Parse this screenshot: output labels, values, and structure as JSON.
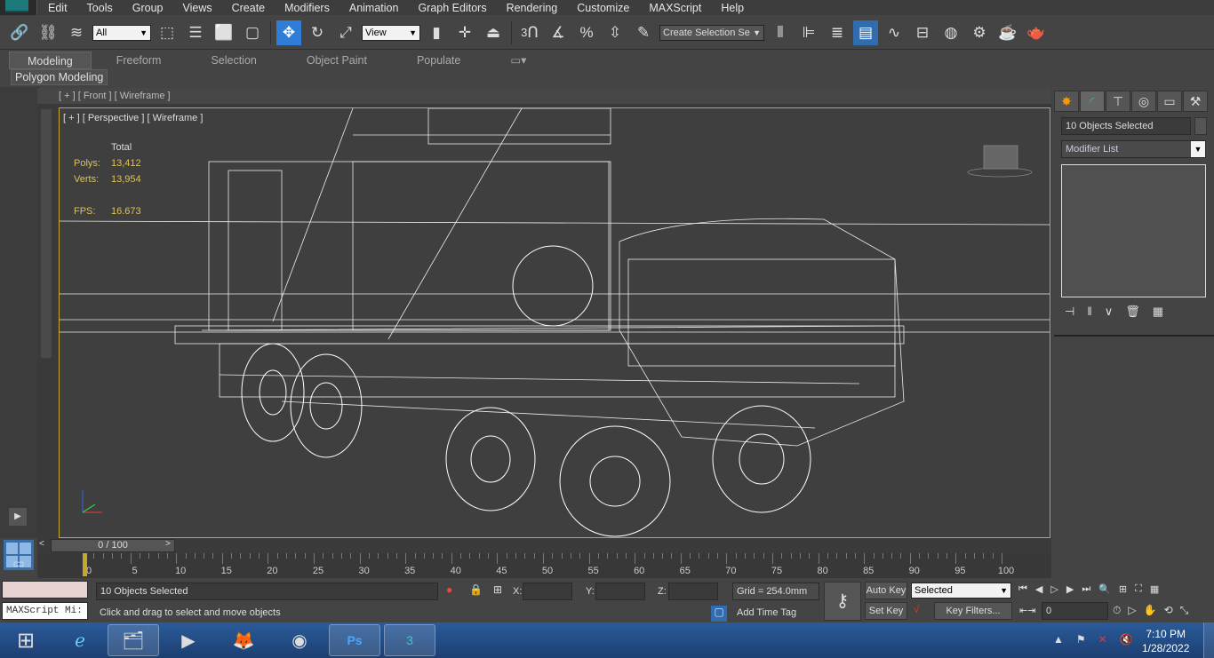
{
  "menu": [
    "Edit",
    "Tools",
    "Group",
    "Views",
    "Create",
    "Modifiers",
    "Animation",
    "Graph Editors",
    "Rendering",
    "Customize",
    "MAXScript",
    "Help"
  ],
  "toolbar": {
    "selection_filter": "All",
    "ref_coord": "View",
    "named_selection": "Create Selection Se",
    "snap_value": "3"
  },
  "ribbon": {
    "tabs": [
      "Modeling",
      "Freeform",
      "Selection",
      "Object Paint",
      "Populate"
    ],
    "active": "Modeling",
    "panel": "Polygon Modeling"
  },
  "viewports": {
    "front_label": "[ + ] [ Front ] [ Wireframe ]",
    "perspective_label": "[ + ] [ Perspective ] [ Wireframe ]"
  },
  "stats": {
    "header": "Total",
    "polys_label": "Polys:",
    "polys": "13,412",
    "verts_label": "Verts:",
    "verts": "13,954",
    "fps_label": "FPS:",
    "fps": "16.673"
  },
  "command_panel": {
    "object_name": "10 Objects Selected",
    "modifier_list": "Modifier List"
  },
  "timeline": {
    "slider": "0 / 100",
    "ticks": [
      "0",
      "5",
      "10",
      "15",
      "20",
      "25",
      "30",
      "35",
      "40",
      "45",
      "50",
      "55",
      "60",
      "65",
      "70",
      "75",
      "80",
      "85",
      "90",
      "95",
      "100"
    ]
  },
  "status": {
    "maxscript": "MAXScript Mi:",
    "selection": "10 Objects Selected",
    "prompt": "Click and drag to select and move objects",
    "x_label": "X:",
    "y_label": "Y:",
    "z_label": "Z:",
    "grid": "Grid = 254.0mm",
    "add_time_tag": "Add Time Tag",
    "auto_key": "Auto Key",
    "set_key": "Set Key",
    "key_mode": "Selected",
    "key_filters": "Key Filters...",
    "frame": "0"
  },
  "taskbar": {
    "time": "7:10 PM",
    "date": "1/28/2022"
  },
  "colors": {
    "viewport_border": "#c9a62e",
    "active_tool": "#2f7dd6",
    "stats": "#e0c15a"
  }
}
